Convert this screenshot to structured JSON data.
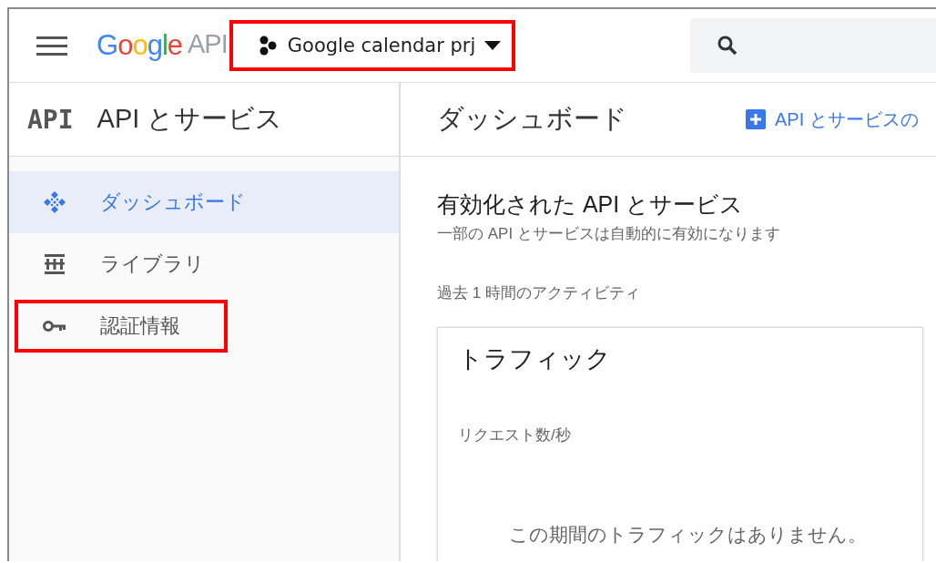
{
  "header": {
    "logo": {
      "brand": "Google",
      "product": "API"
    },
    "project": {
      "name": "Google calendar prj",
      "highlighted": true
    }
  },
  "sidebar": {
    "badge": "API",
    "title": "API とサービス",
    "items": [
      {
        "label": "ダッシュボード",
        "kind": "dashboard",
        "selected": true,
        "highlighted": false
      },
      {
        "label": "ライブラリ",
        "kind": "library",
        "selected": false,
        "highlighted": false
      },
      {
        "label": "認証情報",
        "kind": "credentials",
        "selected": false,
        "highlighted": true
      }
    ]
  },
  "main": {
    "title": "ダッシュボード",
    "action": "API とサービスの",
    "heading": "有効化された API とサービス",
    "subheading": "一部の API とサービスは自動的に有効になります",
    "period": "過去 1 時間のアクティビティ",
    "card": {
      "title": "トラフィック",
      "metric": "リクエスト数/秒",
      "empty": "この期間のトラフィックはありません。"
    }
  }
}
